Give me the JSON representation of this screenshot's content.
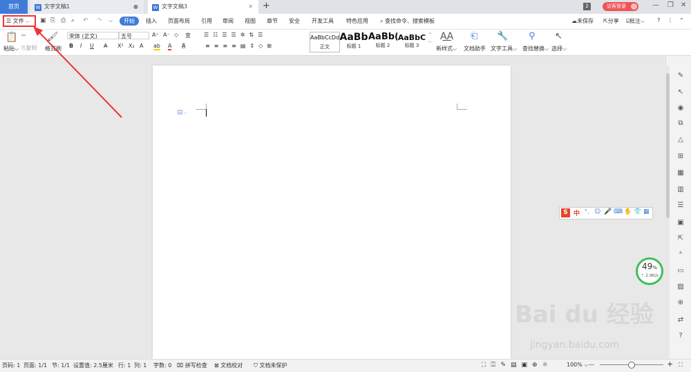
{
  "tabs": {
    "home": "首页",
    "doc1": "文字文稿1",
    "doc2": "文字文稿3",
    "new": "+"
  },
  "titlebar": {
    "badge": "2",
    "login": "访客登录"
  },
  "menu": {
    "file": "文件",
    "start": "开始",
    "items": [
      "插入",
      "页面布局",
      "引用",
      "审阅",
      "视图",
      "章节",
      "安全",
      "开发工具",
      "特色应用"
    ],
    "search": "查找命令、搜索模板",
    "unsaved": "未保存",
    "share": "分享",
    "comment": "批注"
  },
  "ribbon": {
    "paste": "粘贴",
    "cut_copy": "复制",
    "format_painter": "格式刷",
    "font": "宋体 (正文)",
    "size": "五号",
    "styles": [
      {
        "sample": "AaBbCcDd",
        "label": "正文"
      },
      {
        "sample": "AaBb",
        "label": "标题 1"
      },
      {
        "sample": "AaBb(",
        "label": "标题 2"
      },
      {
        "sample": "AaBbC",
        "label": "标题 3"
      }
    ],
    "new_style": "新样式",
    "doc_helper": "文档助手",
    "text_tools": "文字工具",
    "find_replace": "查找替换",
    "select": "选择"
  },
  "ime": {
    "lang": "中"
  },
  "network": {
    "percent": "49",
    "percent_unit": "%",
    "speed": "2.9K/s"
  },
  "status": {
    "page_num": "页码: 1",
    "pages": "页面: 1/1",
    "section": "节: 1/1",
    "setting": "设置值: 2.5厘米",
    "row": "行: 1",
    "col": "列: 1",
    "words": "字数: 0",
    "spell": "拼写检查",
    "proof": "文档校对",
    "protect": "文档未保护",
    "zoom": "100%"
  },
  "watermark": {
    "main": "Bai du 经验",
    "url": "jingyan.baidu.com"
  },
  "colors": {
    "accent": "#3f7bd8",
    "highlight_border": "#e33333",
    "arrow": "#e33333",
    "progress": "#3ebf5a"
  }
}
